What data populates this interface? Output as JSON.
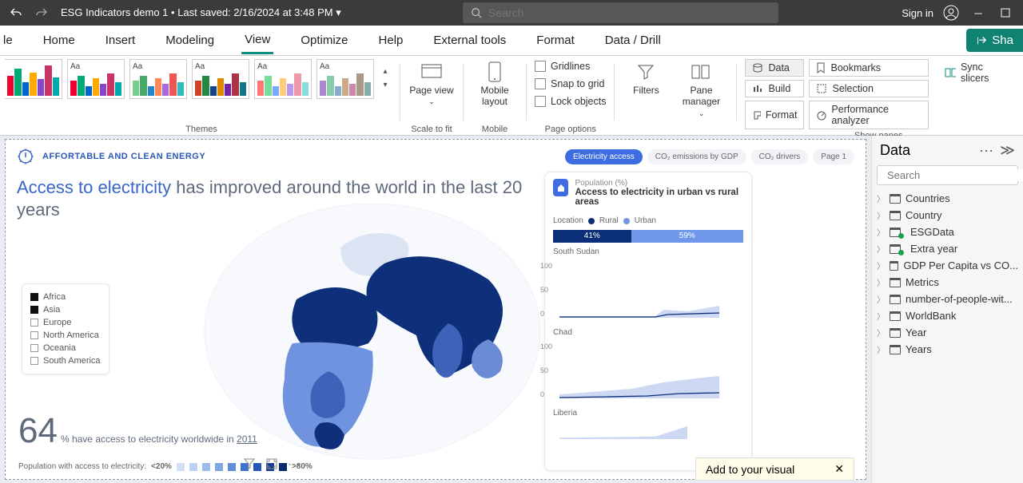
{
  "titlebar": {
    "file_title": "ESG Indicators demo 1",
    "saved": "Last saved: 2/16/2024 at 3:48 PM",
    "search_placeholder": "Search",
    "signin": "Sign in"
  },
  "ribbon": {
    "tabs": [
      "le",
      "Home",
      "Insert",
      "Modeling",
      "View",
      "Optimize",
      "Help",
      "External tools",
      "Format",
      "Data / Drill"
    ],
    "active_tab": "View",
    "share_label": "Sha",
    "groups": {
      "themes_label": "Themes",
      "scale_label": "Scale to fit",
      "mobile_label": "Mobile",
      "page_options_label": "Page options",
      "show_panes_label": "Show panes",
      "page_view": "Page view",
      "mobile_layout": "Mobile layout",
      "gridlines": "Gridlines",
      "snap_to_grid": "Snap to grid",
      "lock_objects": "Lock objects",
      "filters": "Filters",
      "pane_manager": "Pane manager",
      "data": "Data",
      "build": "Build",
      "format": "Format",
      "bookmarks": "Bookmarks",
      "selection": "Selection",
      "perf_analyzer": "Performance analyzer",
      "sync_slicers": "Sync slicers"
    }
  },
  "report": {
    "brand": "AFFORTABLE AND CLEAN ENERGY",
    "pills": [
      "Electricity access",
      "CO₂ emissions by GDP",
      "CO₂ drivers",
      "Page 1"
    ],
    "active_pill": 0,
    "headline_accent": "Access to electricity",
    "headline_rest": " has improved around the world in the last 20 years",
    "legend_items": [
      {
        "name": "Africa",
        "checked": true
      },
      {
        "name": "Asia",
        "checked": true
      },
      {
        "name": "Europe",
        "checked": false
      },
      {
        "name": "North America",
        "checked": false
      },
      {
        "name": "Oceania",
        "checked": false
      },
      {
        "name": "South America",
        "checked": false
      }
    ],
    "stat_big": "64",
    "stat_text": "% have access to electricity worldwide in ",
    "stat_year": "2011",
    "scale_label": "Population with access to electricity:",
    "scale_low": "<20%",
    "scale_high": ">80%",
    "right": {
      "sub": "Population (%)",
      "title": "Access to electricity in urban vs rural areas",
      "location": "Location",
      "rural": "Rural",
      "urban": "Urban",
      "rural_pct": "41%",
      "urban_pct": "59%",
      "countries": [
        "South Sudan",
        "Chad",
        "Liberia"
      ],
      "y_ticks": [
        "100",
        "50",
        "0"
      ]
    },
    "add_visual": "Add to your visual"
  },
  "data_pane": {
    "title": "Data",
    "search_placeholder": "Search",
    "tables": [
      "Countries",
      "Country",
      "ESGData",
      "Extra year",
      "GDP Per Capita vs CO...",
      "Metrics",
      "number-of-people-wit...",
      "WorldBank",
      "Year",
      "Years"
    ],
    "badged": [
      "ESGData",
      "Extra year"
    ]
  },
  "chart_data": {
    "type": "line",
    "series_count": 2,
    "y_range": [
      0,
      100
    ],
    "note": "three small multiples; values not labeled, approximate area charts urban (light) vs rural (dark)"
  }
}
